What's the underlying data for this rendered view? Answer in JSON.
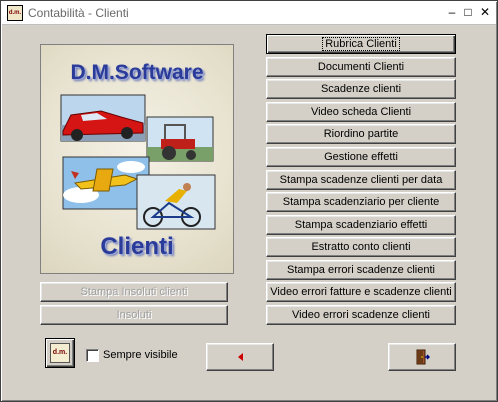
{
  "window": {
    "title": "Contabilità - Clienti",
    "app_icon_text": "d.m.",
    "controls": {
      "minimize": "–",
      "maximize": "□",
      "close": "✕"
    }
  },
  "splash": {
    "brand": "D.M.Software",
    "module": "Clienti",
    "images": [
      "car",
      "tractor",
      "airplane",
      "cyclist"
    ]
  },
  "menu_buttons": [
    {
      "label": "Rubrica Clienti",
      "default": true
    },
    {
      "label": "Documenti Clienti"
    },
    {
      "label": "Scadenze clienti"
    },
    {
      "label": "Video scheda Clienti"
    },
    {
      "label": "Riordino partite"
    },
    {
      "label": "Gestione effetti"
    },
    {
      "label": "Stampa scadenze clienti per data"
    },
    {
      "label": "Stampa scadenziario per cliente"
    },
    {
      "label": "Stampa scadenziario effetti"
    },
    {
      "label": "Estratto conto clienti"
    },
    {
      "label": "Stampa errori scadenze clienti"
    },
    {
      "label": "Video errori fatture e scadenze clienti"
    },
    {
      "label": "Video errori scadenze clienti"
    }
  ],
  "left_buttons": {
    "stampa_insoluti": "Stampa Insoluti clienti",
    "insoluti": "Insoluti"
  },
  "footer": {
    "logo_text": "d.m.",
    "sempre_visibile_label": "Sempre visibile",
    "sempre_visibile_checked": false,
    "back_icon": "arrow-left-icon",
    "exit_icon": "door-exit-icon"
  },
  "colors": {
    "face": "#d4d0c8",
    "brand_text": "#2a3b9a",
    "back_arrow": "#cc0000"
  }
}
